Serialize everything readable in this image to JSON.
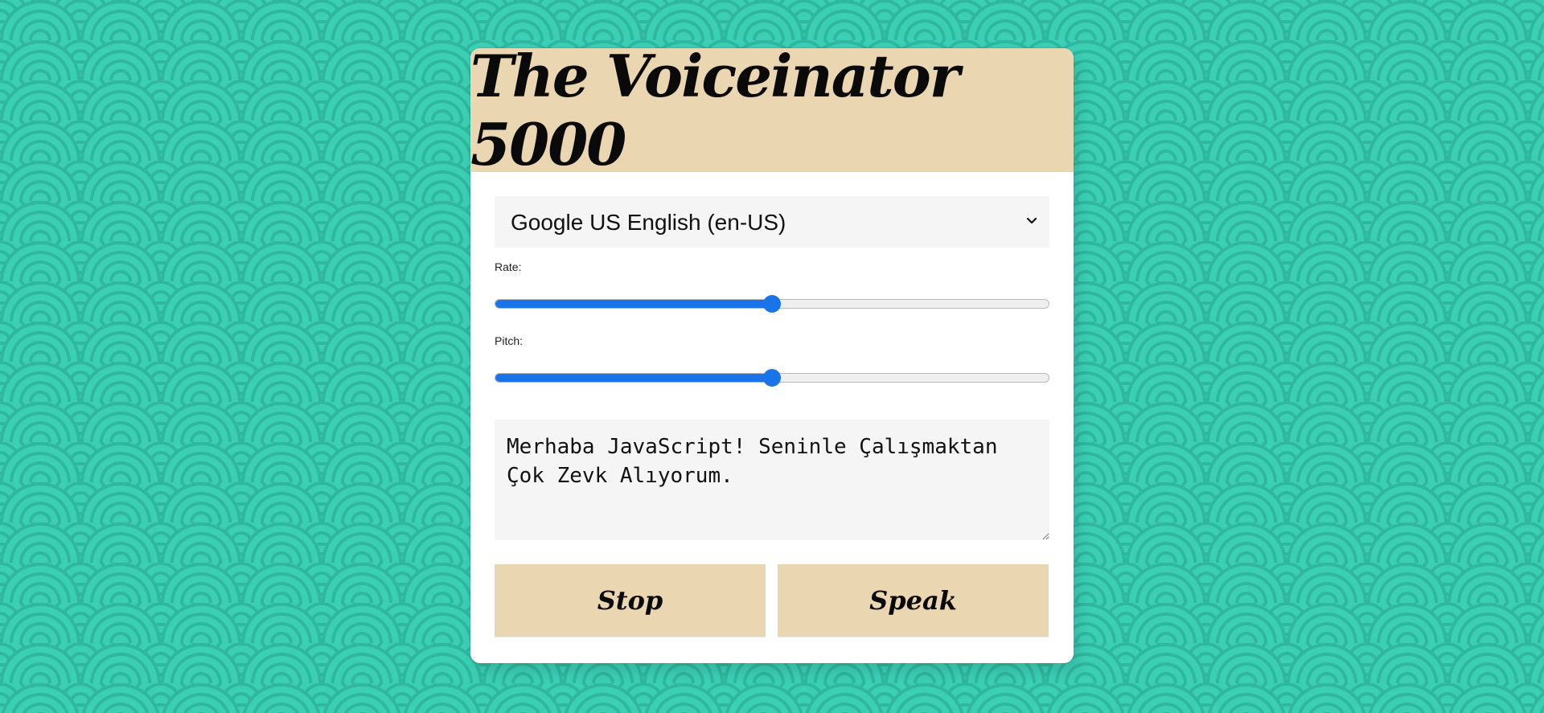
{
  "app": {
    "title": "The Voiceinator 5000"
  },
  "voice_select": {
    "selected": "Google US English (en-US)",
    "options": [
      "Google US English (en-US)"
    ]
  },
  "rate": {
    "label": "Rate:",
    "value_fraction": 0.5
  },
  "pitch": {
    "label": "Pitch:",
    "value_fraction": 0.5
  },
  "message": {
    "text": "Merhaba JavaScript! Seninle Çalışmaktan Çok Zevk Alıyorum."
  },
  "buttons": {
    "stop_label": "Stop",
    "speak_label": "Speak"
  },
  "colors": {
    "background": "#3bcfb6",
    "accent": "#ead6b1",
    "slider": "#1a73e8",
    "panel": "#ffffff"
  },
  "icons": {
    "select_arrow": "chevron-down-icon"
  }
}
